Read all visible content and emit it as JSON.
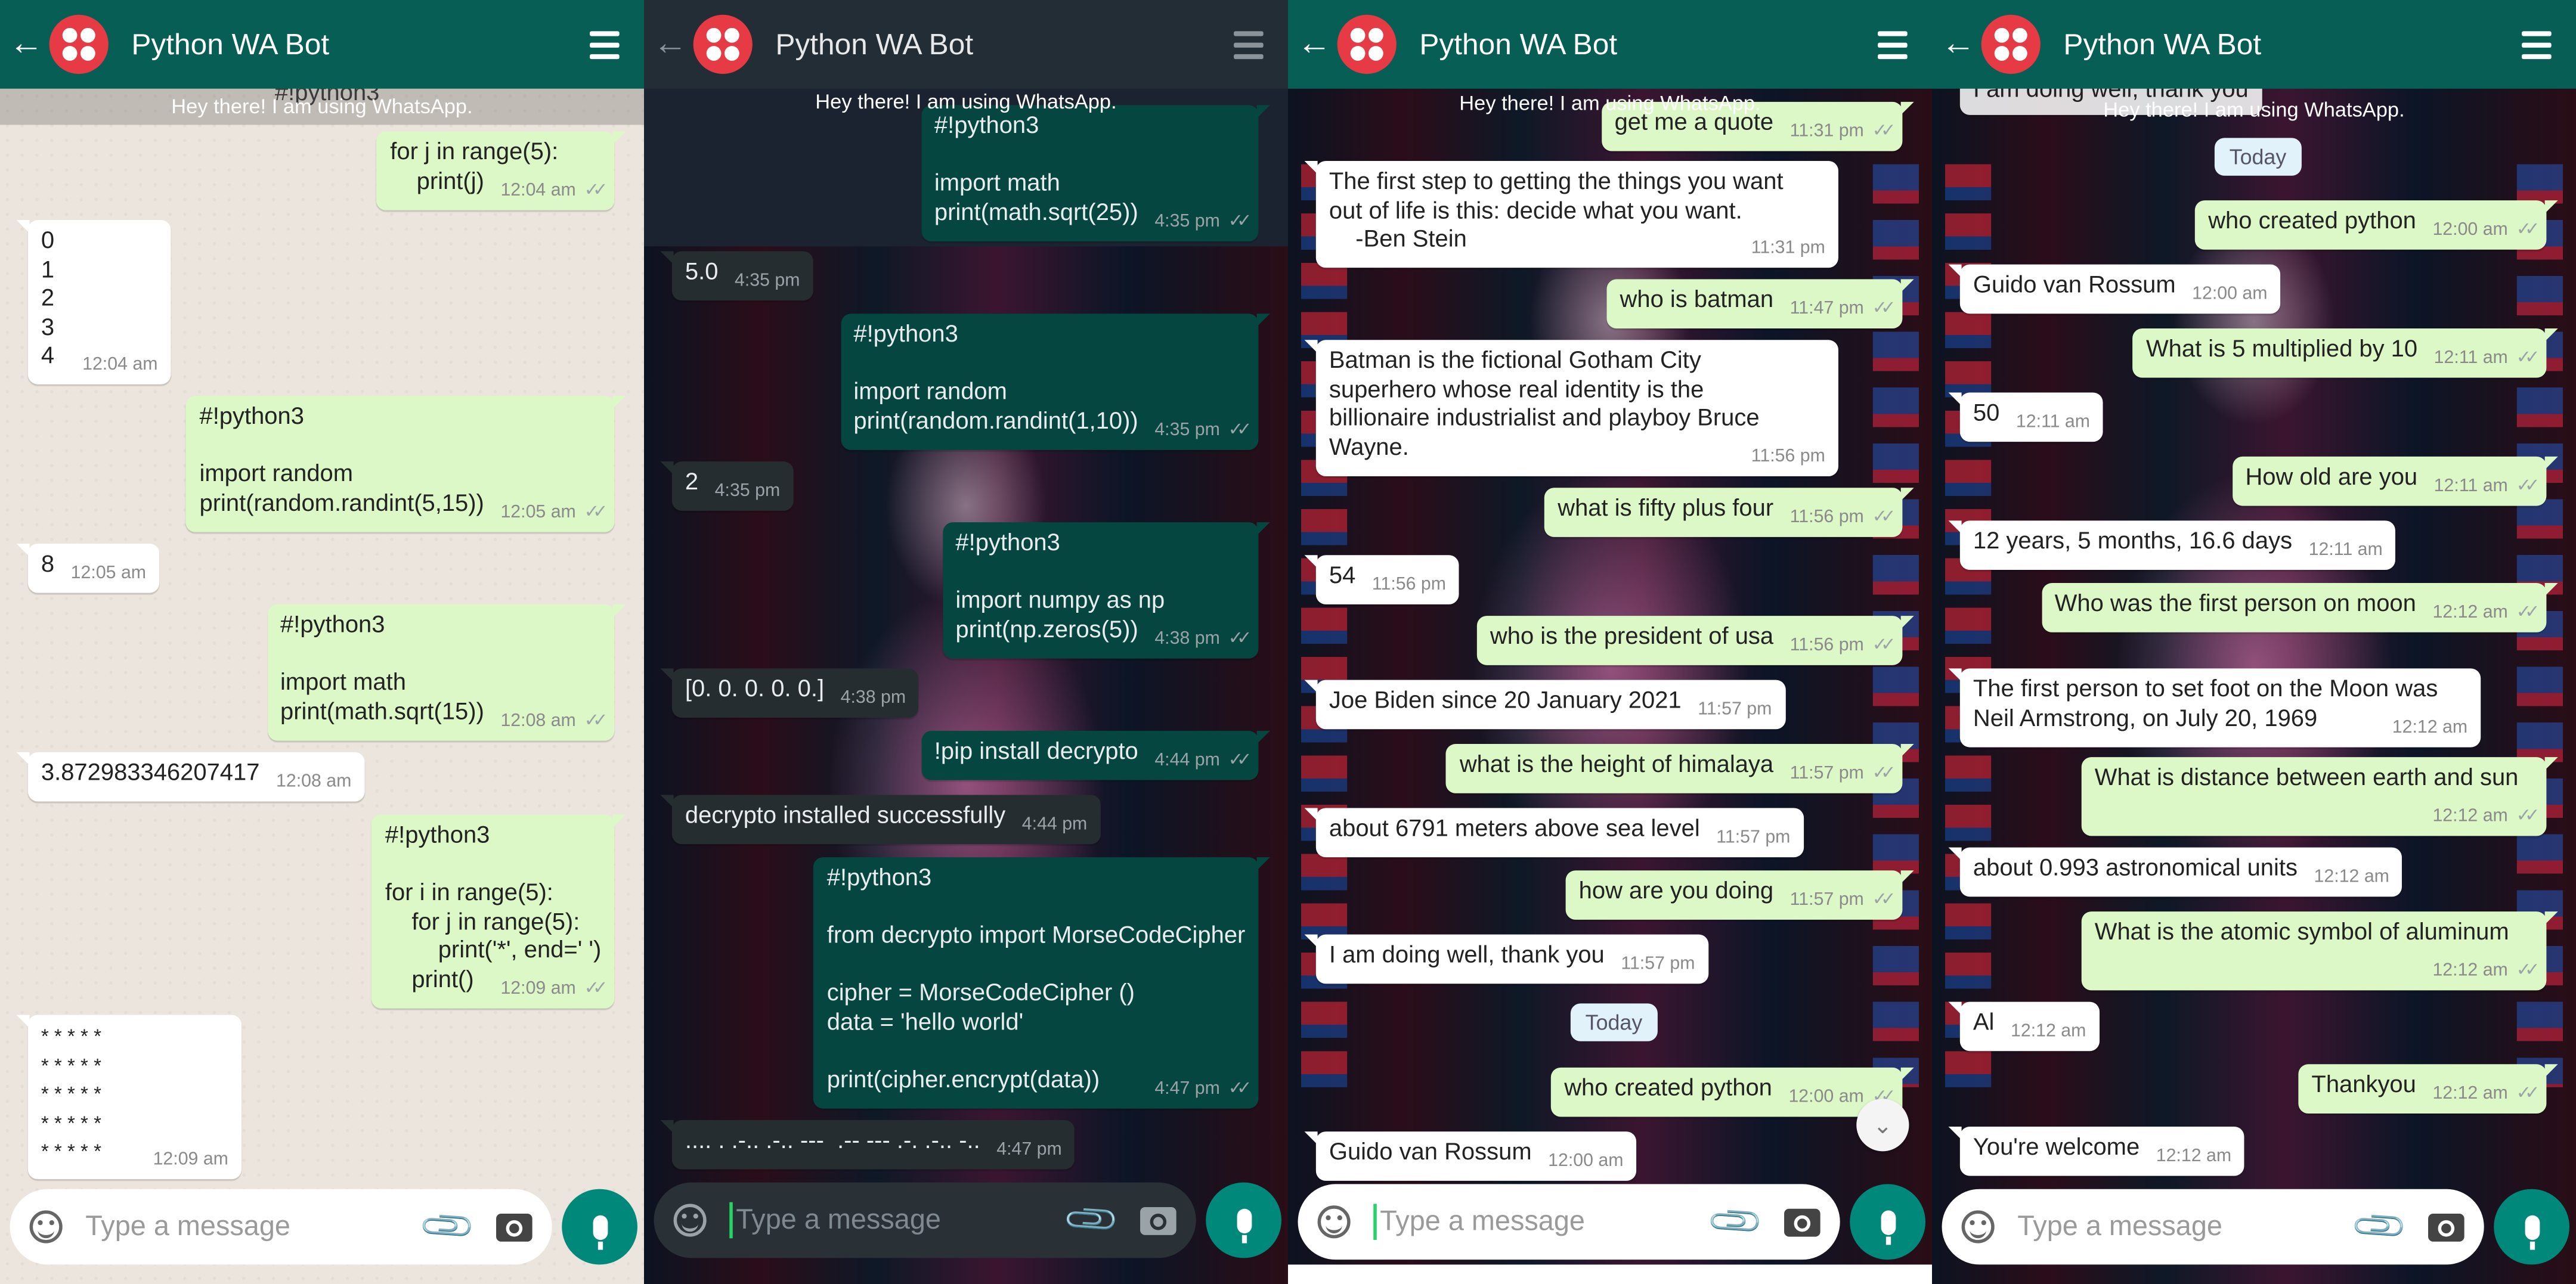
{
  "app": {
    "title": "Python WA Bot",
    "status": "Hey there! I am using WhatsApp."
  },
  "composer": {
    "placeholder": "Type a message"
  },
  "colors": {
    "header": "#075e54",
    "outgoing_bubble": "#dcf8c6",
    "incoming_bubble": "#ffffff",
    "dark_outgoing_bubble": "#054740",
    "dark_incoming_bubble": "#262d31",
    "mic_button": "#00897b"
  },
  "icons": [
    "back-arrow-icon",
    "bot-logo-icon",
    "menu-icon",
    "emoji-icon",
    "attach-icon",
    "camera-icon",
    "mic-icon",
    "double-check-icon",
    "chevron-down-icon"
  ],
  "panel1": {
    "top_fragment": "#!python3",
    "messages": [
      {
        "dir": "out",
        "text": "for j in range(5):\n    print(j)",
        "time": "12:04 am"
      },
      {
        "dir": "in",
        "text": "0\n1\n2\n3\n4",
        "time": "12:04 am"
      },
      {
        "dir": "out",
        "text": "#!python3\n\nimport random\nprint(random.randint(5,15))",
        "time": "12:05 am"
      },
      {
        "dir": "in",
        "text": "8",
        "time": "12:05 am"
      },
      {
        "dir": "out",
        "text": "#!python3\n\nimport math\nprint(math.sqrt(15))",
        "time": "12:08 am"
      },
      {
        "dir": "in",
        "text": "3.872983346207417",
        "time": "12:08 am"
      },
      {
        "dir": "out",
        "text": "#!python3\n\nfor i in range(5):\n    for j in range(5):\n        print('*', end=' ')\n    print()",
        "time": "12:09 am"
      },
      {
        "dir": "in",
        "text": "* * * * *\n* * * * *\n* * * * *\n* * * * *\n* * * * *",
        "time": "12:09 am"
      }
    ]
  },
  "panel2": {
    "messages": [
      {
        "dir": "out",
        "text": "#!python3\n\nimport math\nprint(math.sqrt(25))",
        "time": "4:35 pm"
      },
      {
        "dir": "in",
        "text": "5.0",
        "time": "4:35 pm"
      },
      {
        "dir": "out",
        "text": "#!python3\n\nimport random\nprint(random.randint(1,10))",
        "time": "4:35 pm"
      },
      {
        "dir": "in",
        "text": "2",
        "time": "4:35 pm"
      },
      {
        "dir": "out",
        "text": "#!python3\n\nimport numpy as np\nprint(np.zeros(5))",
        "time": "4:38 pm"
      },
      {
        "dir": "in",
        "text": "[0. 0. 0. 0. 0.]",
        "time": "4:38 pm"
      },
      {
        "dir": "out",
        "text": "!pip install decrypto",
        "time": "4:44 pm"
      },
      {
        "dir": "in",
        "text": "decrypto installed successfully",
        "time": "4:44 pm"
      },
      {
        "dir": "out",
        "text": "#!python3\n\nfrom decrypto import MorseCodeCipher\n\ncipher = MorseCodeCipher ()\ndata = 'hello world'\n\nprint(cipher.encrypt(data))",
        "time": "4:47 pm"
      },
      {
        "dir": "in",
        "text": ".... . .-.. .-.. ---  .-- --- .-. .-.. -..",
        "time": "4:47 pm"
      }
    ]
  },
  "panel3": {
    "date_chip": "Today",
    "messages": [
      {
        "dir": "out",
        "text": "get me a quote",
        "time": "11:31 pm"
      },
      {
        "dir": "in",
        "text": "The first step to getting the things you want\nout of life is this: decide what you want.\n    -Ben Stein",
        "time": "11:31 pm"
      },
      {
        "dir": "out",
        "text": "who is batman",
        "time": "11:47 pm"
      },
      {
        "dir": "in",
        "text": "Batman is the fictional Gotham City\nsuperhero whose real identity is the\nbillionaire industrialist and playboy Bruce\nWayne.",
        "time": "11:56 pm"
      },
      {
        "dir": "out",
        "text": "what is fifty plus four",
        "time": "11:56 pm"
      },
      {
        "dir": "in",
        "text": "54",
        "time": "11:56 pm"
      },
      {
        "dir": "out",
        "text": "who is the president of usa",
        "time": "11:56 pm"
      },
      {
        "dir": "in",
        "text": "Joe Biden since 20 January 2021",
        "time": "11:57 pm"
      },
      {
        "dir": "out",
        "text": "what is the height of himalaya",
        "time": "11:57 pm"
      },
      {
        "dir": "in",
        "text": "about 6791 meters above sea level",
        "time": "11:57 pm"
      },
      {
        "dir": "out",
        "text": "how are you doing",
        "time": "11:57 pm"
      },
      {
        "dir": "in",
        "text": "I am doing well, thank you",
        "time": "11:57 pm"
      },
      {
        "dir": "out",
        "text": "who created python",
        "time": "12:00 am"
      },
      {
        "dir": "in",
        "text": "Guido van Rossum",
        "time": "12:00 am"
      }
    ]
  },
  "panel4": {
    "top_fragment": "I am doing well, thank you",
    "date_chip": "Today",
    "messages": [
      {
        "dir": "out",
        "text": "who created python",
        "time": "12:00 am"
      },
      {
        "dir": "in",
        "text": "Guido van Rossum",
        "time": "12:00 am"
      },
      {
        "dir": "out",
        "text": "What is 5 multiplied by 10",
        "time": "12:11 am"
      },
      {
        "dir": "in",
        "text": "50",
        "time": "12:11 am"
      },
      {
        "dir": "out",
        "text": "How old are you",
        "time": "12:11 am"
      },
      {
        "dir": "in",
        "text": "12 years, 5 months, 16.6 days",
        "time": "12:11 am"
      },
      {
        "dir": "out",
        "text": "Who was the first person on moon",
        "time": "12:12 am"
      },
      {
        "dir": "in",
        "text": "The first person to set foot on the Moon was\nNeil Armstrong, on July 20, 1969",
        "time": "12:12 am"
      },
      {
        "dir": "out",
        "text": "What is distance between earth and sun",
        "time": "12:12 am"
      },
      {
        "dir": "in",
        "text": "about 0.993 astronomical units",
        "time": "12:12 am"
      },
      {
        "dir": "out",
        "text": "What is the atomic symbol of aluminum",
        "time": "12:12 am"
      },
      {
        "dir": "in",
        "text": "Al",
        "time": "12:12 am"
      },
      {
        "dir": "out",
        "text": "Thankyou",
        "time": "12:12 am"
      },
      {
        "dir": "in",
        "text": "You're welcome",
        "time": "12:12 am"
      }
    ]
  }
}
